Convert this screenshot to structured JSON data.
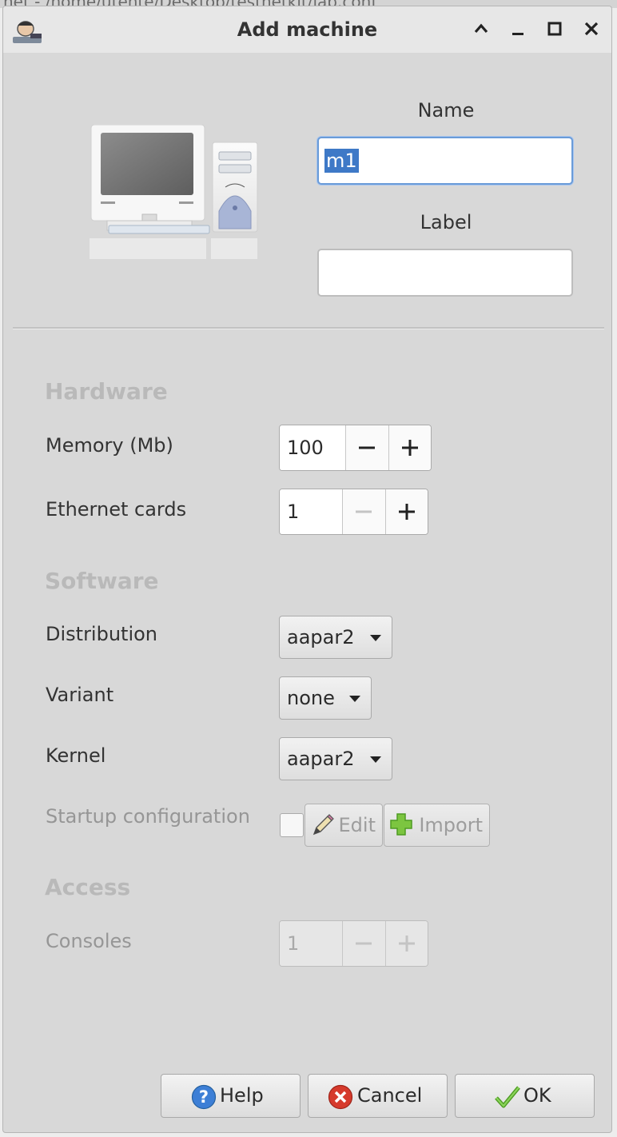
{
  "background_window": {
    "title_fragment": "net - /home/utente/Desktop/testnetkit/lab.conf"
  },
  "dialog": {
    "title": "Add machine",
    "name": {
      "label": "Name",
      "value": "m1"
    },
    "label": {
      "label": "Label",
      "value": ""
    },
    "hardware": {
      "heading": "Hardware",
      "memory_label": "Memory (Mb)",
      "memory_value": "100",
      "ethernet_label": "Ethernet cards",
      "ethernet_value": "1"
    },
    "software": {
      "heading": "Software",
      "distribution_label": "Distribution",
      "distribution_value": "aapar2",
      "variant_label": "Variant",
      "variant_value": "none",
      "kernel_label": "Kernel",
      "kernel_value": "aapar2",
      "startup_label": "Startup configuration",
      "startup_checked": false,
      "edit_label": "Edit",
      "import_label": "Import"
    },
    "access": {
      "heading": "Access",
      "consoles_label": "Consoles",
      "consoles_value": "1"
    },
    "buttons": {
      "help": "Help",
      "cancel": "Cancel",
      "ok": "OK"
    }
  },
  "colors": {
    "selection": "#3e79c7",
    "focus_border": "#6a9bd8",
    "help_icon": "#3d7fd6",
    "cancel_icon": "#d63a2c",
    "ok_icon": "#6cb33f",
    "import_icon": "#7cc540"
  }
}
